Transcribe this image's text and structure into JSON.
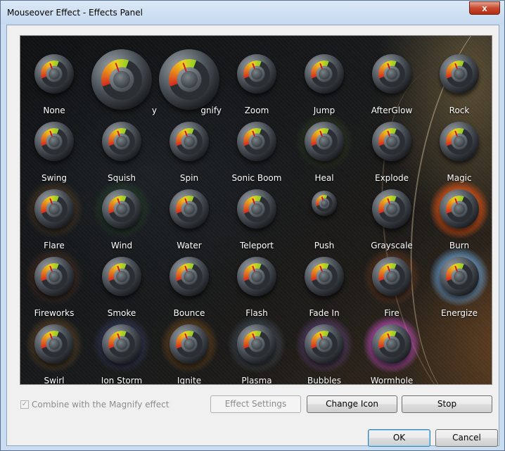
{
  "window": {
    "title": "Mouseover Effect - Effects Panel",
    "close_label": "x"
  },
  "effects": [
    {
      "label": "None",
      "size": "normal"
    },
    {
      "label": "y",
      "size": "big"
    },
    {
      "label": "gnify",
      "size": "big"
    },
    {
      "label": "Zoom",
      "size": "normal"
    },
    {
      "label": "Jump",
      "size": "normal"
    },
    {
      "label": "AfterGlow",
      "size": "normal"
    },
    {
      "label": "Rock",
      "size": "normal"
    },
    {
      "label": "Swing",
      "size": "normal"
    },
    {
      "label": "Squish",
      "size": "normal"
    },
    {
      "label": "Spin",
      "size": "normal"
    },
    {
      "label": "Sonic Boom",
      "size": "normal"
    },
    {
      "label": "Heal",
      "size": "normal"
    },
    {
      "label": "Explode",
      "size": "normal"
    },
    {
      "label": "Magic",
      "size": "normal"
    },
    {
      "label": "Flare",
      "size": "normal"
    },
    {
      "label": "Wind",
      "size": "normal"
    },
    {
      "label": "Water",
      "size": "normal"
    },
    {
      "label": "Teleport",
      "size": "normal"
    },
    {
      "label": "Push",
      "size": "small"
    },
    {
      "label": "Grayscale",
      "size": "normal"
    },
    {
      "label": "Burn",
      "size": "normal"
    },
    {
      "label": "Fireworks",
      "size": "normal"
    },
    {
      "label": "Smoke",
      "size": "normal"
    },
    {
      "label": "Bounce",
      "size": "normal"
    },
    {
      "label": "Flash",
      "size": "normal"
    },
    {
      "label": "Fade In",
      "size": "normal"
    },
    {
      "label": "Fire",
      "size": "normal"
    },
    {
      "label": "Energize",
      "size": "normal"
    },
    {
      "label": "Swirl",
      "size": "normal"
    },
    {
      "label": "Ion Storm",
      "size": "normal"
    },
    {
      "label": "Ignite",
      "size": "normal"
    },
    {
      "label": "Plasma",
      "size": "normal"
    },
    {
      "label": "Bubbles",
      "size": "normal"
    },
    {
      "label": "Wormhole",
      "size": "normal"
    }
  ],
  "combine_magnify": {
    "label": "Combine with the Magnify effect",
    "checked": true,
    "enabled": false
  },
  "buttons": {
    "effect_settings": "Effect Settings",
    "change_icon": "Change Icon",
    "stop": "Stop",
    "ok": "OK",
    "cancel": "Cancel"
  },
  "colors": {
    "title_bar": "#c5d9ef",
    "close_button": "#c7492f",
    "panel_background": "#141618",
    "gauge_red": "#d22a1f",
    "gauge_yellow": "#ead420",
    "gauge_green": "#8ecf27"
  }
}
